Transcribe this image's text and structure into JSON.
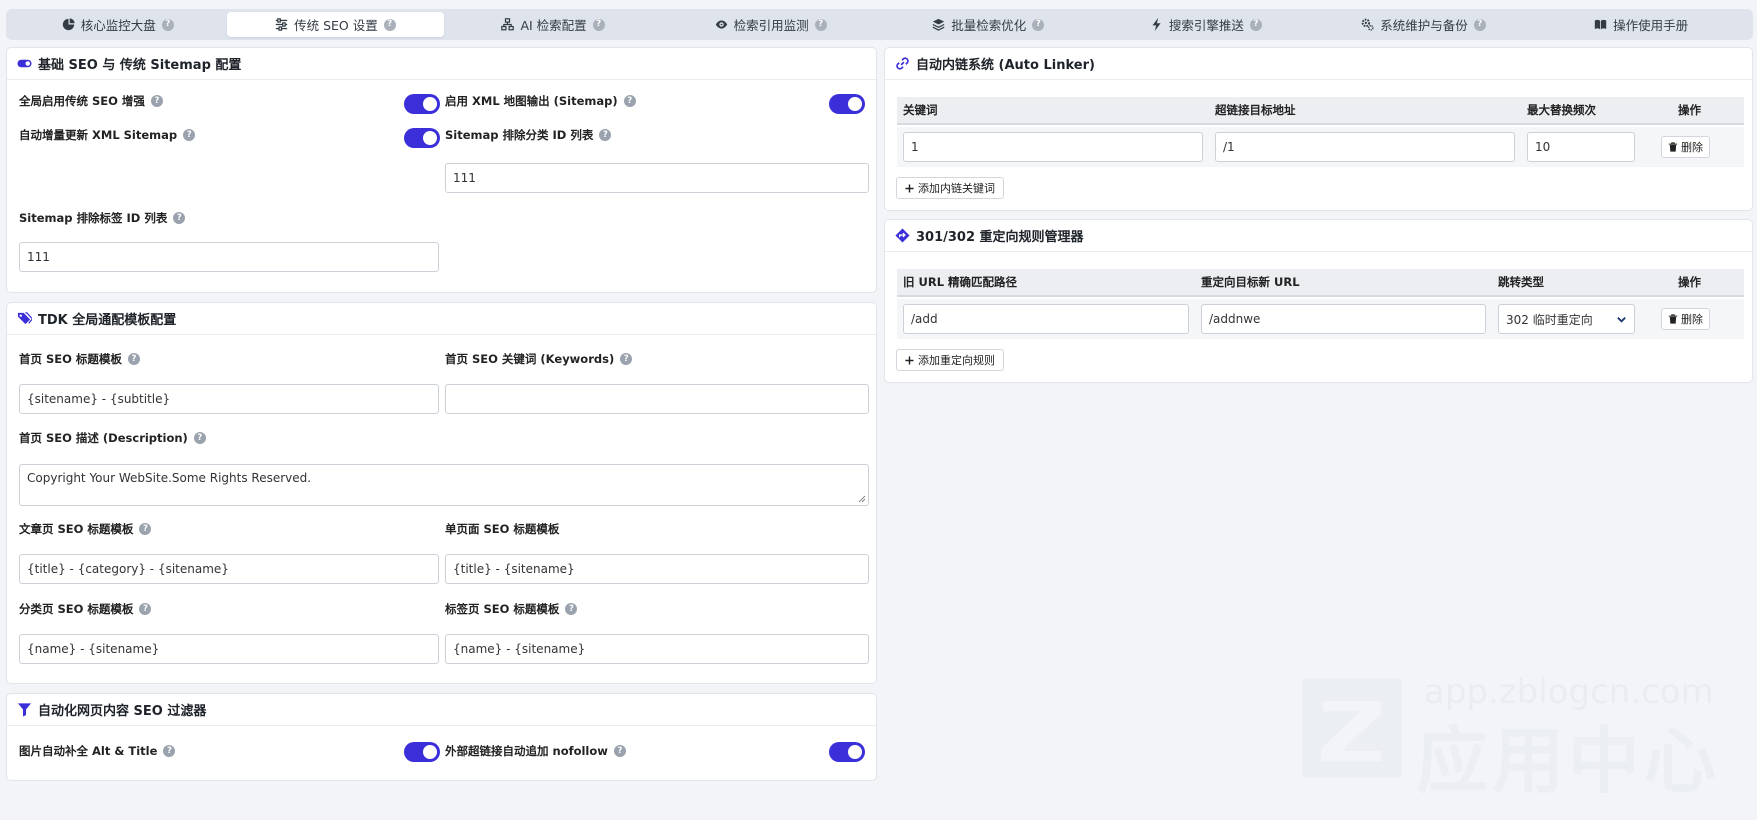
{
  "tabs": [
    {
      "label": "核心监控大盘",
      "icon": "chart-pie-icon",
      "active": false
    },
    {
      "label": "传统 SEO 设置",
      "icon": "sliders-icon",
      "active": true
    },
    {
      "label": "AI 检索配置",
      "icon": "sitemap-icon",
      "active": false
    },
    {
      "label": "检索引用监测",
      "icon": "eye-icon",
      "active": false
    },
    {
      "label": "批量检索优化",
      "icon": "layers-icon",
      "active": false
    },
    {
      "label": "搜索引擎推送",
      "icon": "bolt-icon",
      "active": false
    },
    {
      "label": "系统维护与备份",
      "icon": "gears-icon",
      "active": false
    },
    {
      "label": "操作使用手册",
      "icon": "book-icon",
      "active": false
    }
  ],
  "help_glyph": "?",
  "basic": {
    "title": "基础 SEO 与 传统 Sitemap 配置",
    "enable_seo": {
      "label": "全局启用传统 SEO 增强",
      "on": true
    },
    "enable_sitemap": {
      "label": "启用 XML 地图输出 (Sitemap)",
      "on": true
    },
    "auto_update": {
      "label": "自动增量更新 XML Sitemap",
      "on": true
    },
    "exclude_cat": {
      "label": "Sitemap 排除分类 ID 列表",
      "value": "111"
    },
    "exclude_tag": {
      "label": "Sitemap 排除标签 ID 列表",
      "value": "111"
    }
  },
  "tdk": {
    "title": "TDK 全局通配模板配置",
    "home_title": {
      "label": "首页 SEO 标题模板",
      "value": "{sitename} - {subtitle}"
    },
    "home_keywords": {
      "label": "首页 SEO 关键词 (Keywords)",
      "value": ""
    },
    "home_desc": {
      "label": "首页 SEO 描述 (Description)",
      "value": "Copyright Your WebSite.Some Rights Reserved."
    },
    "article_title": {
      "label": "文章页 SEO 标题模板",
      "value": "{title} - {category} - {sitename}"
    },
    "page_title": {
      "label": "单页面 SEO 标题模板",
      "value": "{title} - {sitename}"
    },
    "category_title": {
      "label": "分类页 SEO 标题模板",
      "value": "{name} - {sitename}"
    },
    "tag_title": {
      "label": "标签页 SEO 标题模板",
      "value": "{name} - {sitename}"
    }
  },
  "filter": {
    "title": "自动化网页内容 SEO 过滤器",
    "img_alt": {
      "label": "图片自动补全 Alt & Title",
      "on": true
    },
    "nofollow": {
      "label": "外部超链接自动追加 nofollow",
      "on": true
    }
  },
  "linker": {
    "title": "自动内链系统 (Auto Linker)",
    "headers": [
      "关键词",
      "超链接目标地址",
      "最大替换频次",
      "操作"
    ],
    "rows": [
      {
        "keyword": "1",
        "url": "/1",
        "max": "10",
        "delete": "删除"
      }
    ],
    "add_label": "添加内链关键词"
  },
  "redirect": {
    "title": "301/302 重定向规则管理器",
    "headers": [
      "旧 URL 精确匹配路径",
      "重定向目标新 URL",
      "跳转类型",
      "操作"
    ],
    "rows": [
      {
        "old": "/add",
        "new": "/addnwe",
        "type": "302 临时重定向",
        "delete": "删除"
      }
    ],
    "add_label": "添加重定向规则"
  },
  "watermark": {
    "url": "app.zblogcn.com",
    "text": "应用中心"
  },
  "colors": {
    "accent": "#3b2fd9"
  }
}
